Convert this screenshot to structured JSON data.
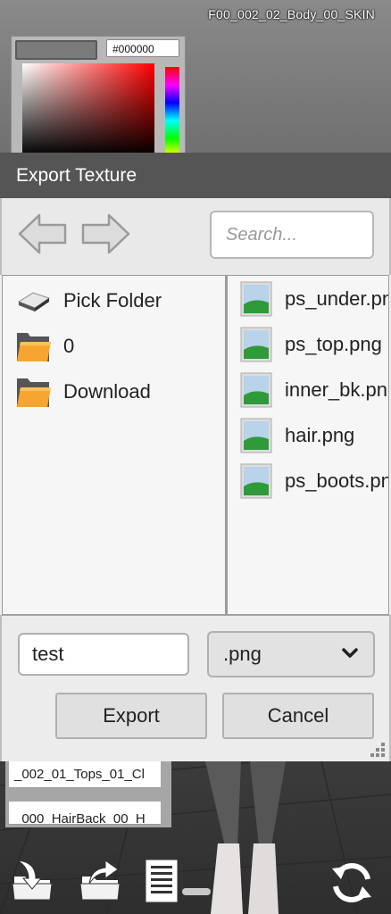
{
  "viewport": {
    "top_label": "F00_002_02_Body_00_SKIN"
  },
  "color_picker": {
    "hex_value": "#000000"
  },
  "dialog": {
    "title": "Export Texture",
    "search_placeholder": "Search...",
    "folders": [
      {
        "label": "Pick Folder",
        "icon": "drive-icon"
      },
      {
        "label": "0",
        "icon": "folder-icon"
      },
      {
        "label": "Download",
        "icon": "folder-icon"
      }
    ],
    "files": [
      {
        "label": "ps_under.png",
        "icon": "image-file-icon"
      },
      {
        "label": "ps_top.png",
        "icon": "image-file-icon"
      },
      {
        "label": "inner_bk.png",
        "icon": "image-file-icon"
      },
      {
        "label": "hair.png",
        "icon": "image-file-icon"
      },
      {
        "label": "ps_boots.png",
        "icon": "image-file-icon"
      }
    ],
    "filename_value": "test",
    "filetype_selected": ".png",
    "export_label": "Export",
    "cancel_label": "Cancel"
  },
  "layer_tags": [
    "_002_01_Tops_01_Cl",
    "_000_HairBack_00_H"
  ],
  "toolbar_icons": [
    "import-icon",
    "export-icon",
    "document-icon",
    "refresh-icon"
  ]
}
